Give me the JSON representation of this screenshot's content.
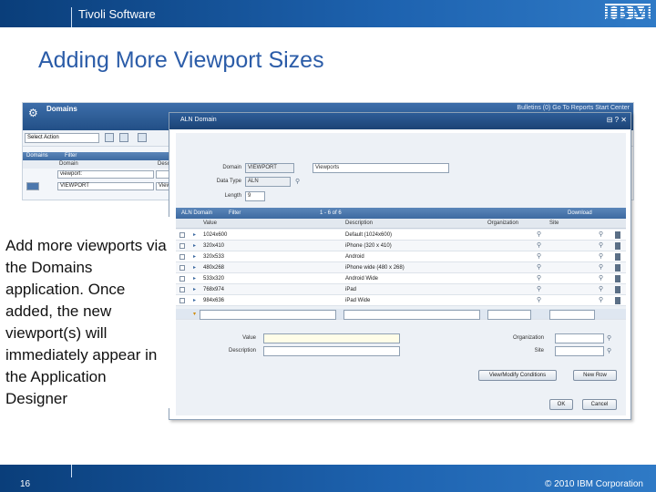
{
  "header": {
    "brand": "Tivoli Software",
    "logo": "IBM",
    "title": "Adding More Viewport Sizes"
  },
  "footer": {
    "page_number": "16",
    "copyright": "© 2010 IBM Corporation"
  },
  "background_app": {
    "app_name": "Domains",
    "header_links": "Bulletins (0)  Go To  Reports  Start Center",
    "select_action": "Select Action",
    "table_tab": "Domains",
    "filter_label": "Filter",
    "columns": [
      "Domain",
      "Desc"
    ],
    "filter_value": "viewport:",
    "row_value": "VIEWPORT",
    "row_desc": "View"
  },
  "dialog": {
    "title": "ALN Domain",
    "domain_label": "Domain",
    "domain_value": "VIEWPORT",
    "domain_desc": "Viewports",
    "data_type_label": "Data Type",
    "data_type_value": "ALN",
    "length_label": "Length",
    "length_value": "9",
    "grid_title": "ALN Domain",
    "grid_filter": "Filter",
    "grid_paging": "1 - 6 of 6",
    "grid_download": "Download",
    "columns": {
      "value": "Value",
      "description": "Description",
      "organization": "Organization",
      "site": "Site"
    },
    "rows": [
      {
        "value": "1024x600",
        "description": "Default (1024x600)"
      },
      {
        "value": "320x410",
        "description": "iPhone (320 x 410)"
      },
      {
        "value": "320x533",
        "description": "Android"
      },
      {
        "value": "480x268",
        "description": "iPhone wide (480 x 268)"
      },
      {
        "value": "533x320",
        "description": "Android Wide"
      },
      {
        "value": "768x974",
        "description": "iPad"
      },
      {
        "value": "984x636",
        "description": "iPad Wide"
      }
    ],
    "detail_value_label": "Value",
    "detail_description_label": "Description",
    "detail_organization_label": "Organization",
    "detail_site_label": "Site",
    "view_modify_button": "View/Modify Conditions",
    "new_row_button": "New Row",
    "ok_button": "OK",
    "cancel_button": "Cancel"
  },
  "callout": {
    "text": "Add more viewports via the Domains application. Once added, the new viewport(s) will immediately appear in the Application Designer"
  },
  "colors": {
    "brand_blue": "#1e63b0",
    "title_blue": "#2b5ca8"
  }
}
